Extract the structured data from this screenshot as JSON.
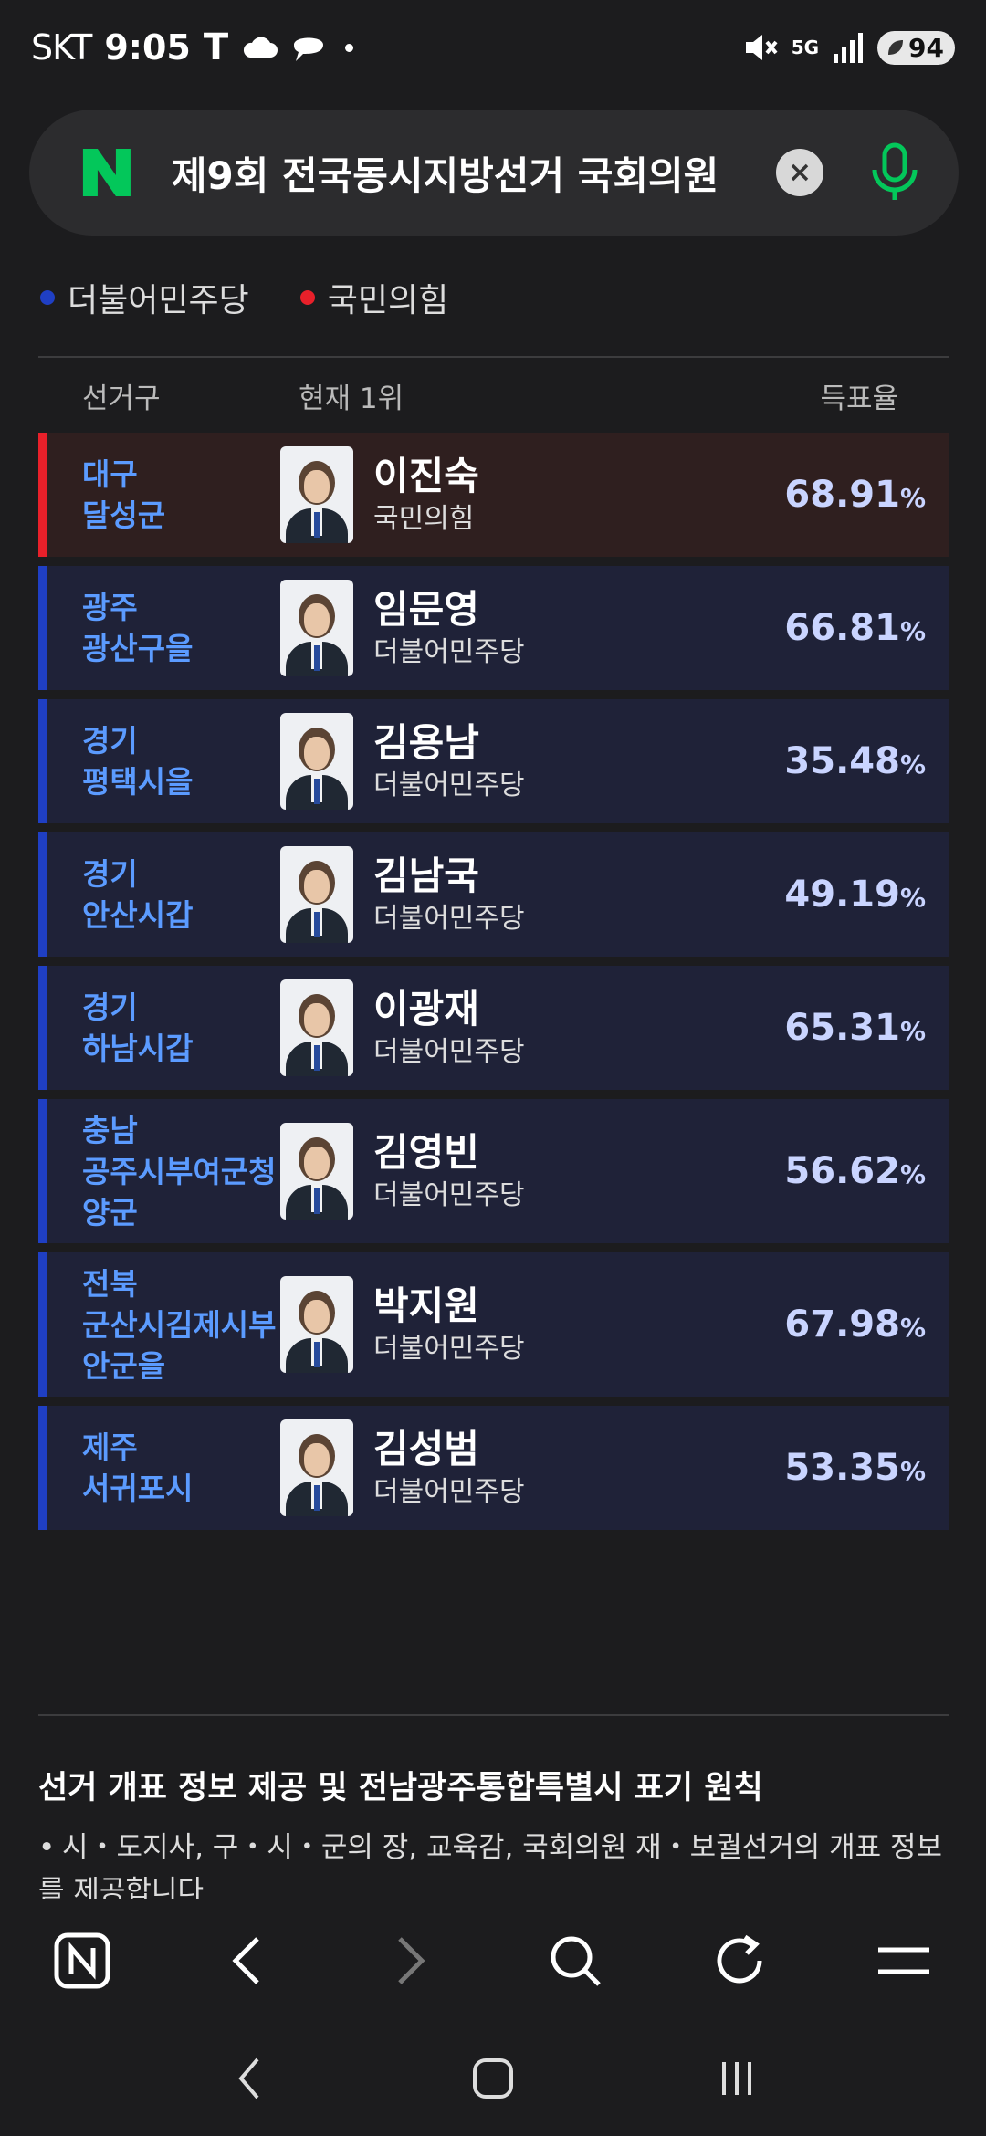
{
  "status_bar": {
    "carrier": "SKT",
    "time": "9:05",
    "network": "5G",
    "battery": "94"
  },
  "search": {
    "query": "제9회 전국동시지방선거 국회의원",
    "brand_color": "#03c75a"
  },
  "legend": [
    {
      "label": "더불어민주당",
      "color": "#1f3fc4"
    },
    {
      "label": "국민의힘",
      "color": "#e8202a"
    }
  ],
  "table": {
    "headers": {
      "district": "선거구",
      "leader": "현재 1위",
      "rate": "득표율"
    },
    "rows": [
      {
        "district": "대구\n달성군",
        "name": "이진숙",
        "party": "국민의힘",
        "rate": "68.91",
        "pct": "%",
        "bar_color": "#e8202a",
        "bg_color": "#2f1f1f"
      },
      {
        "district": "광주\n광산구을",
        "name": "임문영",
        "party": "더불어민주당",
        "rate": "66.81",
        "pct": "%",
        "bar_color": "#1f3fc4",
        "bg_color": "#1f2238"
      },
      {
        "district": "경기\n평택시을",
        "name": "김용남",
        "party": "더불어민주당",
        "rate": "35.48",
        "pct": "%",
        "bar_color": "#1f3fc4",
        "bg_color": "#1f2238"
      },
      {
        "district": "경기\n안산시갑",
        "name": "김남국",
        "party": "더불어민주당",
        "rate": "49.19",
        "pct": "%",
        "bar_color": "#1f3fc4",
        "bg_color": "#1f2238"
      },
      {
        "district": "경기\n하남시갑",
        "name": "이광재",
        "party": "더불어민주당",
        "rate": "65.31",
        "pct": "%",
        "bar_color": "#1f3fc4",
        "bg_color": "#1f2238"
      },
      {
        "district": "충남\n공주시부여군청\n양군",
        "name": "김영빈",
        "party": "더불어민주당",
        "rate": "56.62",
        "pct": "%",
        "bar_color": "#1f3fc4",
        "bg_color": "#1f2238"
      },
      {
        "district": "전북\n군산시김제시부\n안군을",
        "name": "박지원",
        "party": "더불어민주당",
        "rate": "67.98",
        "pct": "%",
        "bar_color": "#1f3fc4",
        "bg_color": "#1f2238"
      },
      {
        "district": "제주\n서귀포시",
        "name": "김성범",
        "party": "더불어민주당",
        "rate": "53.35",
        "pct": "%",
        "bar_color": "#1f3fc4",
        "bg_color": "#1f2238"
      }
    ]
  },
  "notice": {
    "title": "선거 개표 정보 제공 및 전남광주통합특별시 표기 원칙",
    "bullet": "•",
    "text": "시・도지사, 구・시・군의 장, 교육감, 국회의원 재・보궐선거의 개표 정보를 제공합니다"
  },
  "browser_bar": {
    "icons": [
      "naver-home-icon",
      "back-icon",
      "forward-icon",
      "search-icon",
      "refresh-icon",
      "menu-icon"
    ]
  },
  "nav_bar": {
    "icons": [
      "system-back-icon",
      "home-icon",
      "recent-apps-icon"
    ]
  }
}
